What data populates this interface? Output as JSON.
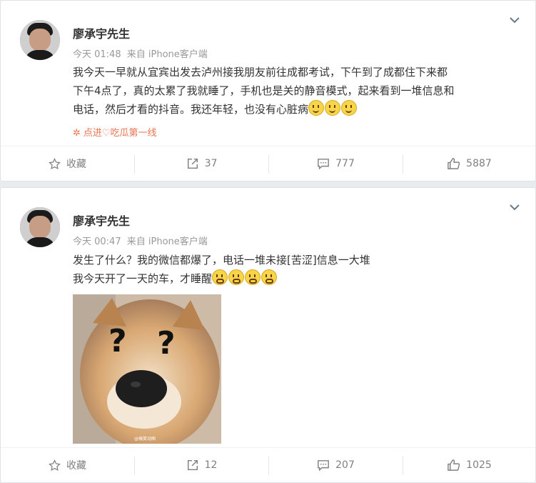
{
  "posts": [
    {
      "author": "廖承宇先生",
      "time": "今天 01:48",
      "source": "来自 iPhone客户端",
      "lines": [
        "我今天一早就从宜宾出发去泸州接我朋友前往成都考试，下午到了成都住下来都",
        "下午4点了，真的太累了我就睡了，手机也是关的静音模式，起来看到一堆信息和",
        "电话，然后才看的抖音。我还年轻，也没有心脏病"
      ],
      "topic": "点进♡吃瓜第一线",
      "actions": {
        "favorite": "收藏",
        "repost": "37",
        "comment": "777",
        "like": "5887"
      }
    },
    {
      "author": "廖承宇先生",
      "time": "今天 00:47",
      "source": "来自 iPhone客户端",
      "lines": [
        "发生了什么？我的微信都爆了，电话一堆未接[苦涩]信息一大堆",
        "我今天开了一天的车，才睡醒"
      ],
      "image_watermark": "@搞笑动图",
      "actions": {
        "favorite": "收藏",
        "repost": "12",
        "comment": "207",
        "like": "1025"
      }
    }
  ],
  "icons": {
    "menu": "chevron-down-icon",
    "favorite": "star-icon",
    "repost": "share-icon",
    "comment": "comment-icon",
    "like": "thumbs-up-icon",
    "emoji": "smile-emoji-icon"
  },
  "colors": {
    "accent": "#eb7350",
    "muted": "#999999",
    "text": "#333333"
  }
}
